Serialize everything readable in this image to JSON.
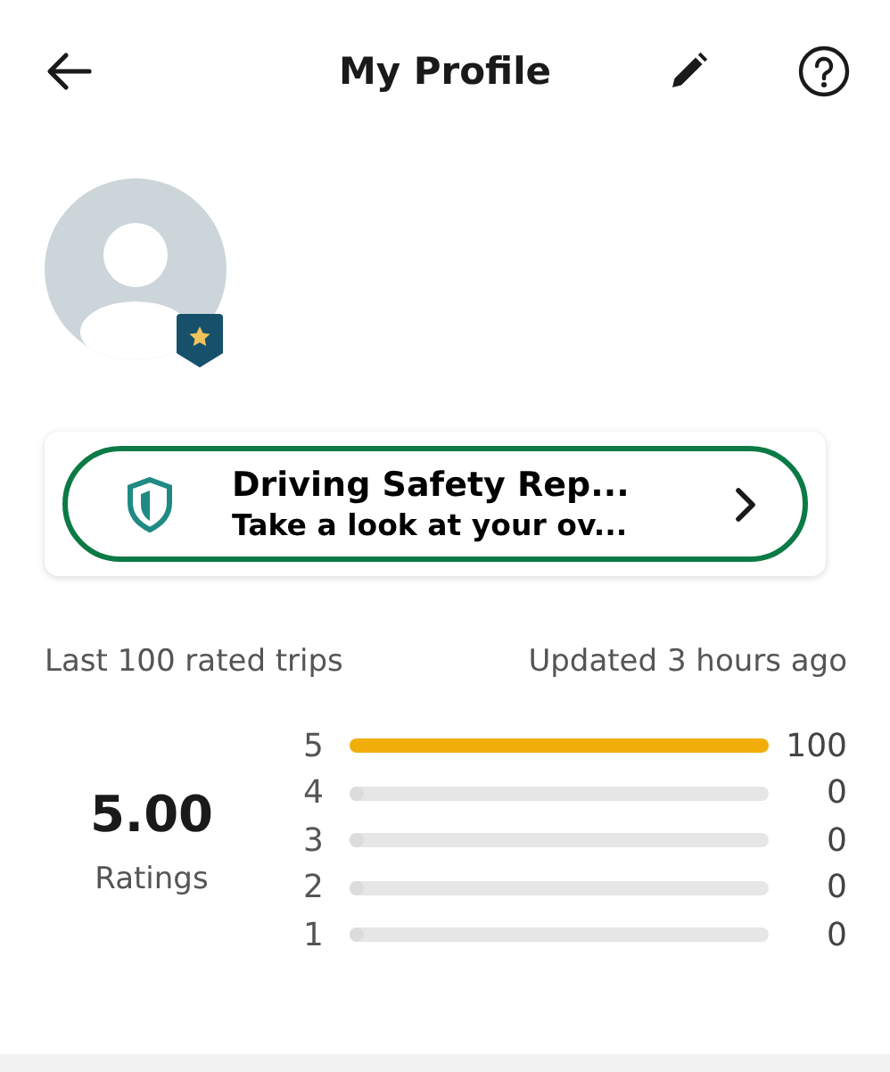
{
  "header": {
    "title": "My Profile"
  },
  "report_card": {
    "title": "Driving Safety Rep...",
    "subtitle": "Take a look at your ov...",
    "highlighted": true
  },
  "ratings": {
    "caption": "Last 100 rated trips",
    "updated": "Updated 3 hours ago",
    "average": "5.00",
    "average_label": "Ratings",
    "rows": [
      {
        "star": "5",
        "level": 1,
        "count": "100"
      },
      {
        "star": "4",
        "level": 0,
        "count": "0"
      },
      {
        "star": "3",
        "level": 0,
        "count": "0"
      },
      {
        "star": "2",
        "level": 0,
        "count": "0"
      },
      {
        "star": "1",
        "level": 0,
        "count": "0"
      }
    ]
  }
}
